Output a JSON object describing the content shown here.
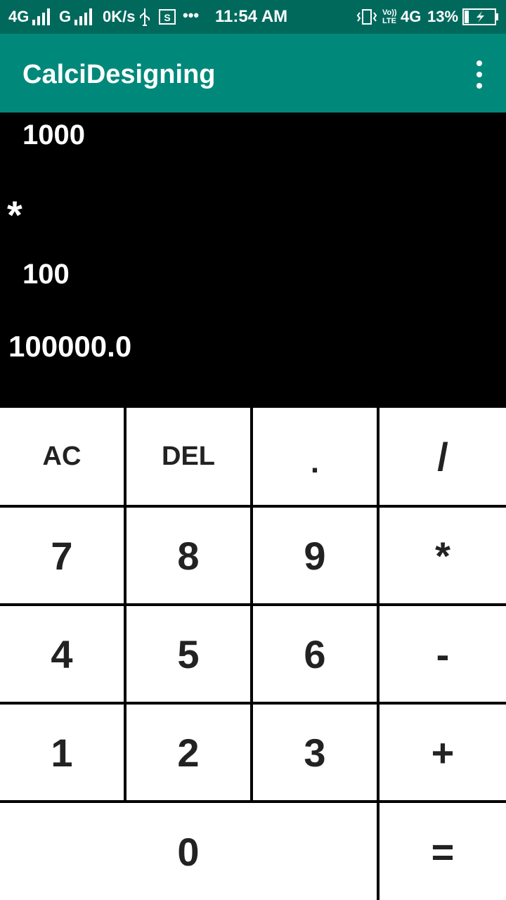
{
  "status_bar": {
    "network1": "4G",
    "network2": "G",
    "speed": "0K/s",
    "time": "11:54 AM",
    "volte": "Vo)) LTE",
    "network3": "4G",
    "battery": "13%",
    "colors": {
      "background": "#00695c"
    }
  },
  "app_bar": {
    "title": "CalciDesigning",
    "menu_icon": "overflow-menu-icon",
    "colors": {
      "background": "#00897b"
    }
  },
  "display": {
    "first_operand": "1000",
    "operator": "*",
    "second_operand": "100",
    "result": "100000.0"
  },
  "keypad": {
    "rows": [
      [
        "AC",
        "DEL",
        ".",
        "/"
      ],
      [
        "7",
        "8",
        "9",
        "*"
      ],
      [
        "4",
        "5",
        "6",
        "-"
      ],
      [
        "1",
        "2",
        "3",
        "+"
      ],
      [
        "0",
        "="
      ]
    ]
  }
}
